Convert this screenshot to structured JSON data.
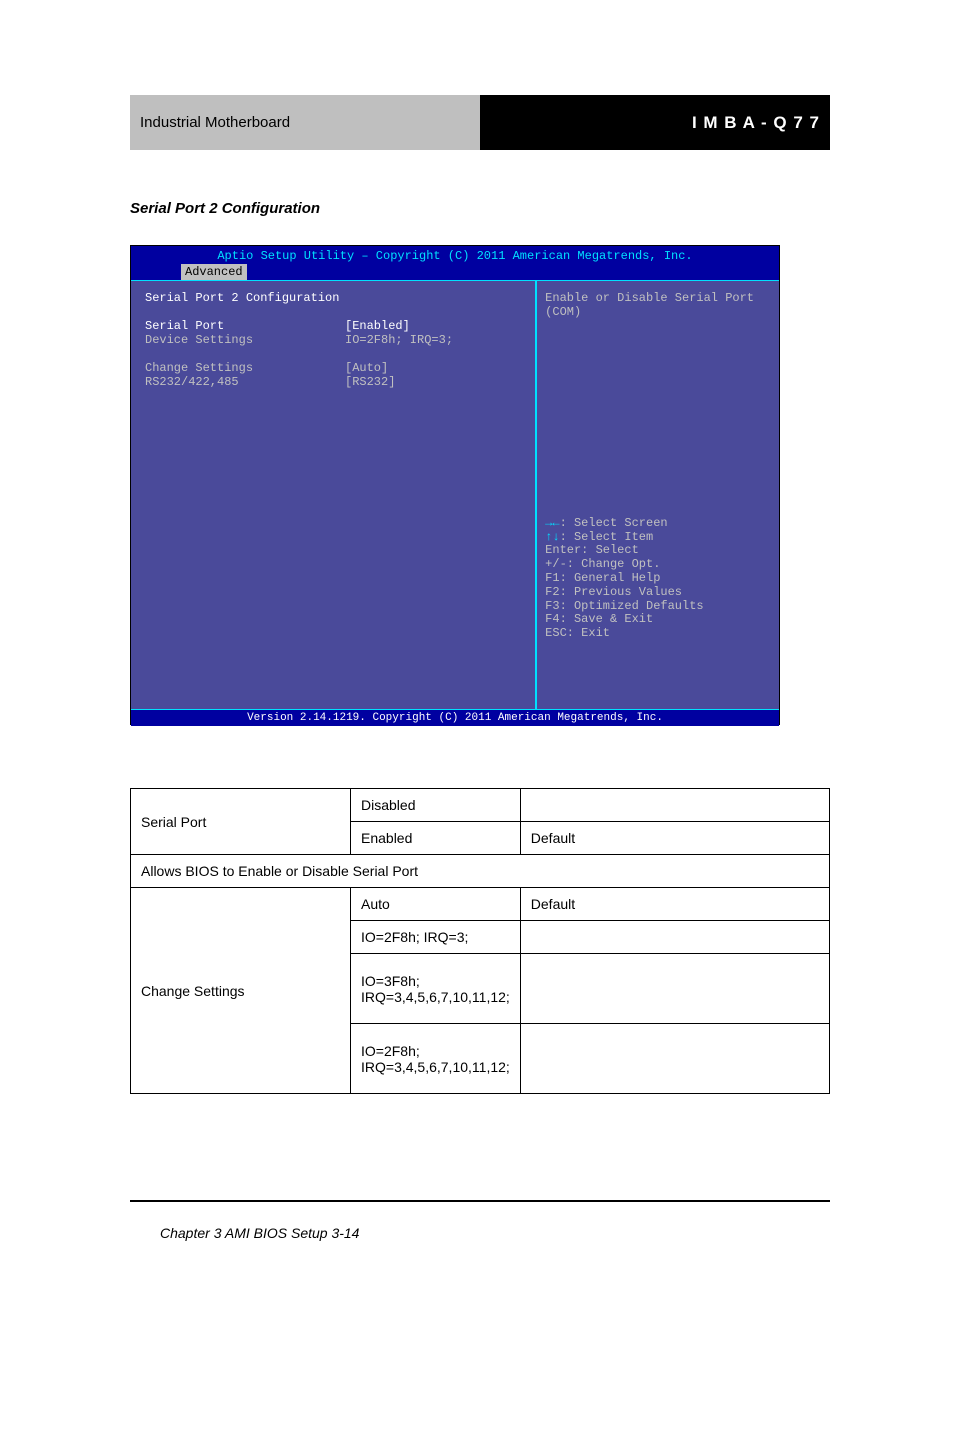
{
  "header": {
    "left": "Industrial Motherboard",
    "right": "I M B A - Q 7 7"
  },
  "subheading": "Serial Port 2 Configuration",
  "bios": {
    "title": "Aptio Setup Utility – Copyright (C) 2011 American Megatrends, Inc.",
    "tab": "Advanced",
    "section_title": "Serial Port 2 Configuration",
    "rows": {
      "serial_port_label": "Serial Port",
      "serial_port_value": "[Enabled]",
      "device_settings_label": "Device Settings",
      "device_settings_value": "IO=2F8h; IRQ=3;",
      "change_settings_label": "Change Settings",
      "change_settings_value": "[Auto]",
      "rs_label": "RS232/422,485",
      "rs_value": "[RS232]"
    },
    "help_desc": "Enable or Disable Serial Port (COM)",
    "keys": {
      "k1a": "→←",
      "k1b": ": Select Screen",
      "k2a": "↑↓",
      "k2b": ": Select Item",
      "k3": "Enter: Select",
      "k4": "+/-: Change Opt.",
      "k5": "F1: General Help",
      "k6": "F2: Previous Values",
      "k7": "F3: Optimized Defaults",
      "k8": "F4: Save & Exit",
      "k9": "ESC: Exit"
    },
    "footer": "Version 2.14.1219. Copyright (C) 2011 American Megatrends, Inc."
  },
  "table": {
    "r1": {
      "a": "Serial Port",
      "b1": "Disabled",
      "b2": "Enabled",
      "c1": "",
      "c2": "Default"
    },
    "note": "Allows BIOS to Enable or Disable Serial Port",
    "r2": {
      "a": "Change Settings",
      "b1": "Auto",
      "c1": "Default",
      "b2": "IO=2F8h; IRQ=3;",
      "c2": "",
      "b3": "IO=3F8h; IRQ=3,4,5,6,7,10,11,12;",
      "c3": "",
      "b4": "IO=2F8h; IRQ=3,4,5,6,7,10,11,12;",
      "c4": ""
    }
  },
  "page_num": "Chapter 3 AMI BIOS Setup                3-14"
}
